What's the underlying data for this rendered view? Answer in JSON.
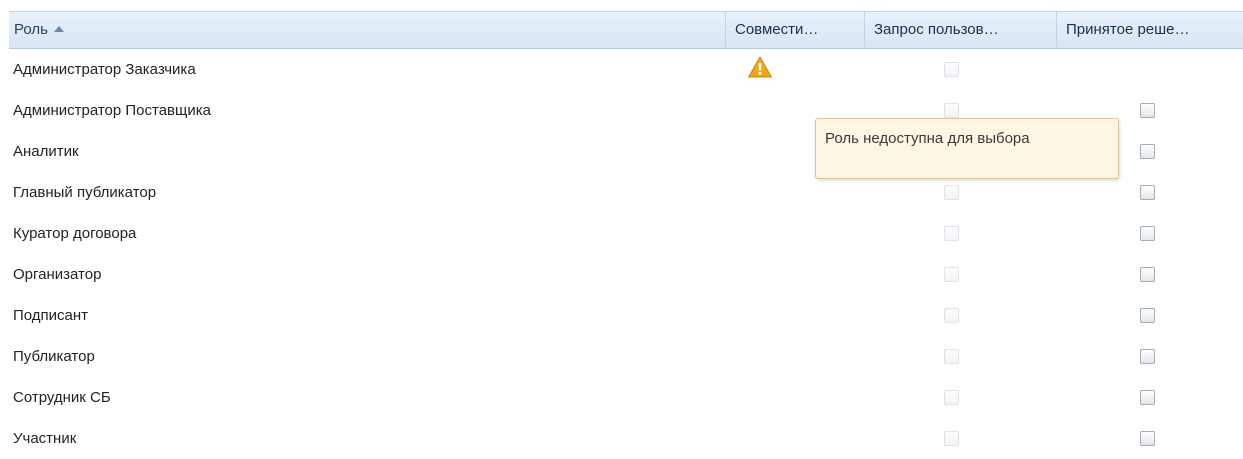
{
  "columns": {
    "role": "Роль",
    "compat": "Совмести…",
    "request": "Запрос пользов…",
    "decision": "Принятое реше…"
  },
  "sort": {
    "column": "role",
    "direction": "ascending",
    "icon": "sort-ascending-icon"
  },
  "rows": [
    {
      "role": "Администратор Заказчика",
      "warning": true,
      "request_checked": false,
      "request_disabled": true,
      "decision_visible": false
    },
    {
      "role": "Администратор Поставщика",
      "warning": false,
      "request_checked": false,
      "request_disabled": true,
      "decision_visible": true,
      "decision_checked": false
    },
    {
      "role": "Аналитик",
      "warning": false,
      "request_checked": false,
      "request_disabled": true,
      "decision_visible": true,
      "decision_checked": false
    },
    {
      "role": "Главный публикатор",
      "warning": false,
      "request_checked": false,
      "request_disabled": true,
      "decision_visible": true,
      "decision_checked": false
    },
    {
      "role": "Куратор договора",
      "warning": false,
      "request_checked": false,
      "request_disabled": true,
      "decision_visible": true,
      "decision_checked": false
    },
    {
      "role": "Организатор",
      "warning": false,
      "request_checked": false,
      "request_disabled": true,
      "decision_visible": true,
      "decision_checked": false
    },
    {
      "role": "Подписант",
      "warning": false,
      "request_checked": false,
      "request_disabled": true,
      "decision_visible": true,
      "decision_checked": false
    },
    {
      "role": "Публикатор",
      "warning": false,
      "request_checked": false,
      "request_disabled": true,
      "decision_visible": true,
      "decision_checked": false
    },
    {
      "role": "Сотрудник СБ",
      "warning": false,
      "request_checked": false,
      "request_disabled": true,
      "decision_visible": true,
      "decision_checked": false
    },
    {
      "role": "Участник",
      "warning": false,
      "request_checked": false,
      "request_disabled": true,
      "decision_visible": true,
      "decision_checked": false
    }
  ],
  "tooltip": {
    "text": "Роль недоступна для выбора"
  },
  "colors": {
    "header_bg": "#dde8f6",
    "tooltip_bg": "#fdf6e2",
    "warning": "#f0a818"
  }
}
